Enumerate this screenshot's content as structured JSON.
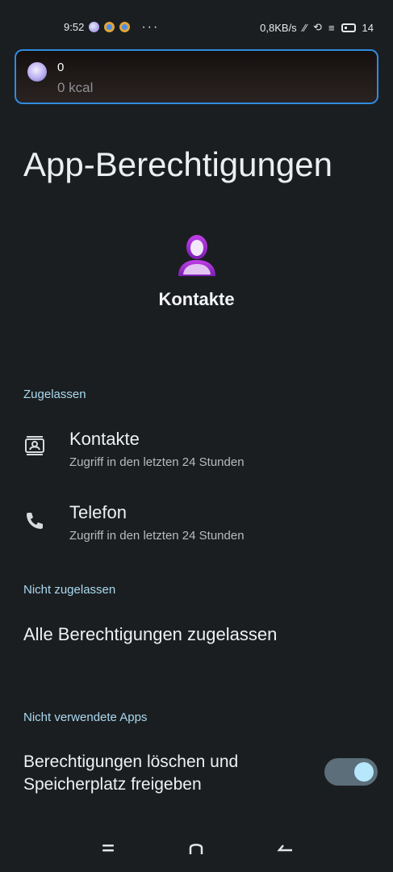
{
  "status_bar": {
    "time": "9:52",
    "more": "···",
    "net_speed": "0,8KB/s",
    "battery": "14"
  },
  "notification": {
    "title": "0",
    "subtitle": "0 kcal"
  },
  "page": {
    "title": "App-Berechtigungen"
  },
  "app": {
    "name": "Kontakte",
    "icon": "contacts-person-icon"
  },
  "sections": {
    "allowed": {
      "header": "Zugelassen",
      "items": [
        {
          "title": "Kontakte",
          "subtitle": "Zugriff in den letzten 24 Stunden",
          "icon": "contacts-card-icon"
        },
        {
          "title": "Telefon",
          "subtitle": "Zugriff in den letzten 24 Stunden",
          "icon": "phone-icon"
        }
      ]
    },
    "not_allowed": {
      "header": "Nicht zugelassen",
      "allow_all_label": "Alle Berechtigungen zugelassen"
    },
    "unused": {
      "header": "Nicht verwendete Apps",
      "cleanup_label": "Berechtigungen löschen und Speicherplatz freigeben",
      "toggle_on": true
    }
  },
  "colors": {
    "background": "#1b1e21",
    "accent": "#a9d9ee",
    "notification_border": "#2f8be0",
    "toggle_track": "#5b6e79",
    "toggle_knob": "#b7e7fb",
    "app_icon": "#a12bd1"
  },
  "nav": {
    "recents_icon": "menu-icon",
    "home_icon": "home-icon",
    "back_icon": "back-icon"
  }
}
